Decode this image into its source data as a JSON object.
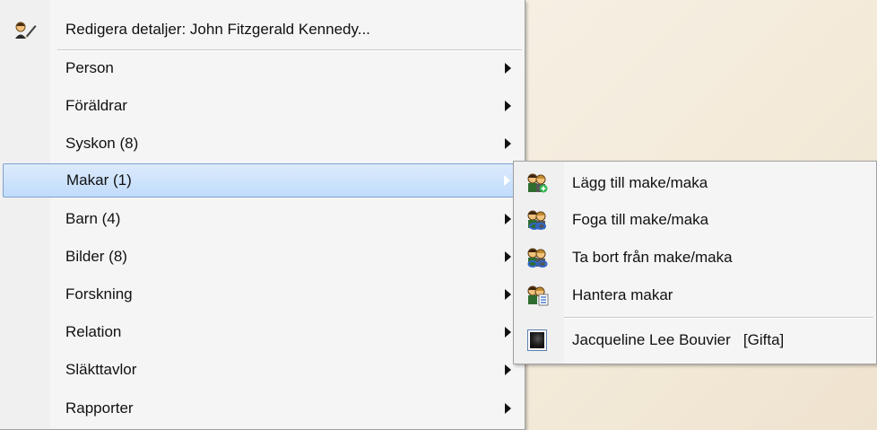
{
  "main_menu": {
    "edit_details": "Redigera detaljer: John Fitzgerald Kennedy...",
    "items": [
      {
        "label": "Person"
      },
      {
        "label": "Föräldrar"
      },
      {
        "label": "Syskon (8)"
      },
      {
        "label": "Makar (1)"
      },
      {
        "label": "Barn (4)"
      },
      {
        "label": "Bilder (8)"
      },
      {
        "label": "Forskning"
      },
      {
        "label": "Relation"
      },
      {
        "label": "Släkttavlor"
      },
      {
        "label": "Rapporter"
      }
    ]
  },
  "sub_menu": {
    "add_spouse": "Lägg till make/maka",
    "join_spouse": "Foga till make/maka",
    "remove_spouse": "Ta bort från make/maka",
    "manage_spouses": "Hantera makar",
    "spouse_name": "Jacqueline Lee Bouvier",
    "spouse_status": "[Gifta]"
  },
  "colors": {
    "highlight_border": "#7da2ce",
    "highlight_fill": "#c1dcfc",
    "menu_bg": "#f5f5f5"
  },
  "icons": {
    "edit": "person-pencil-icon",
    "add": "couple-add-icon",
    "join": "couple-link-icon",
    "remove": "couple-remove-icon",
    "manage": "couple-list-icon",
    "photo": "photo-thumbnail-icon"
  }
}
